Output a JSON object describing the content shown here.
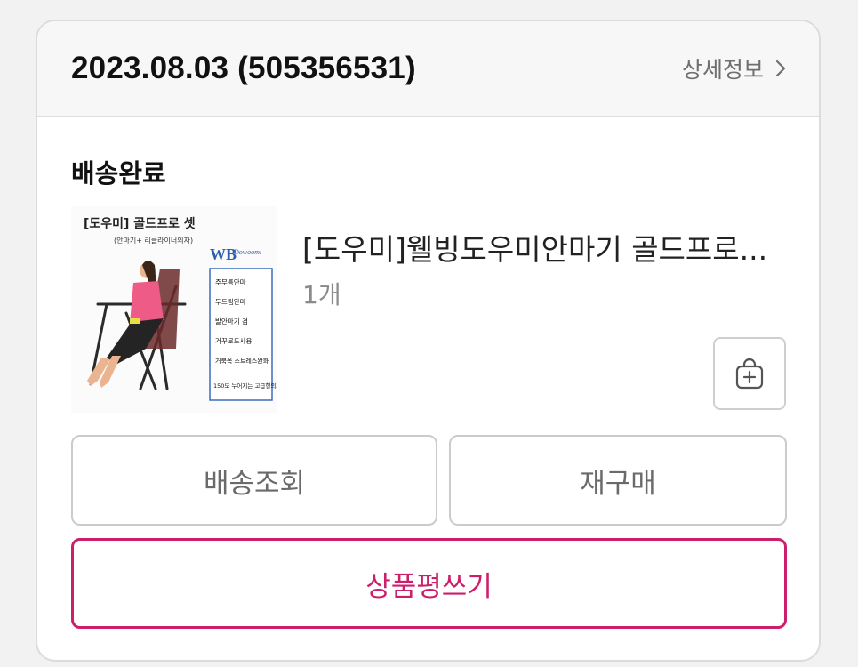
{
  "order": {
    "title": "2023.08.03 (505356531)",
    "detail_label": "상세정보",
    "detail_icon": "chevron-right-icon"
  },
  "shipment": {
    "status": "배송완료",
    "product": {
      "name": "[도우미]웰빙도우미안마기 골드프로...",
      "quantity": "1개",
      "image": {
        "headline": "[도우미] 골드프로 셋",
        "subhead": "(안마기+ 리클라이너의자)",
        "brand": "WB",
        "features": [
          "주무름안마",
          "두드림안마",
          "발안마기 겸",
          "거꾸로도사용",
          "거북목 스트레스완화",
          "150도 누어지는 고급형의자"
        ]
      }
    },
    "add_to_cart_icon": "shopping-bag-plus-icon"
  },
  "actions": {
    "track_label": "배송조회",
    "rebuy_label": "재구매",
    "review_label": "상품평쓰기"
  },
  "colors": {
    "accent": "#cc1f6b",
    "border": "#cbcbcb",
    "header_bg": "#f7f7f7"
  }
}
